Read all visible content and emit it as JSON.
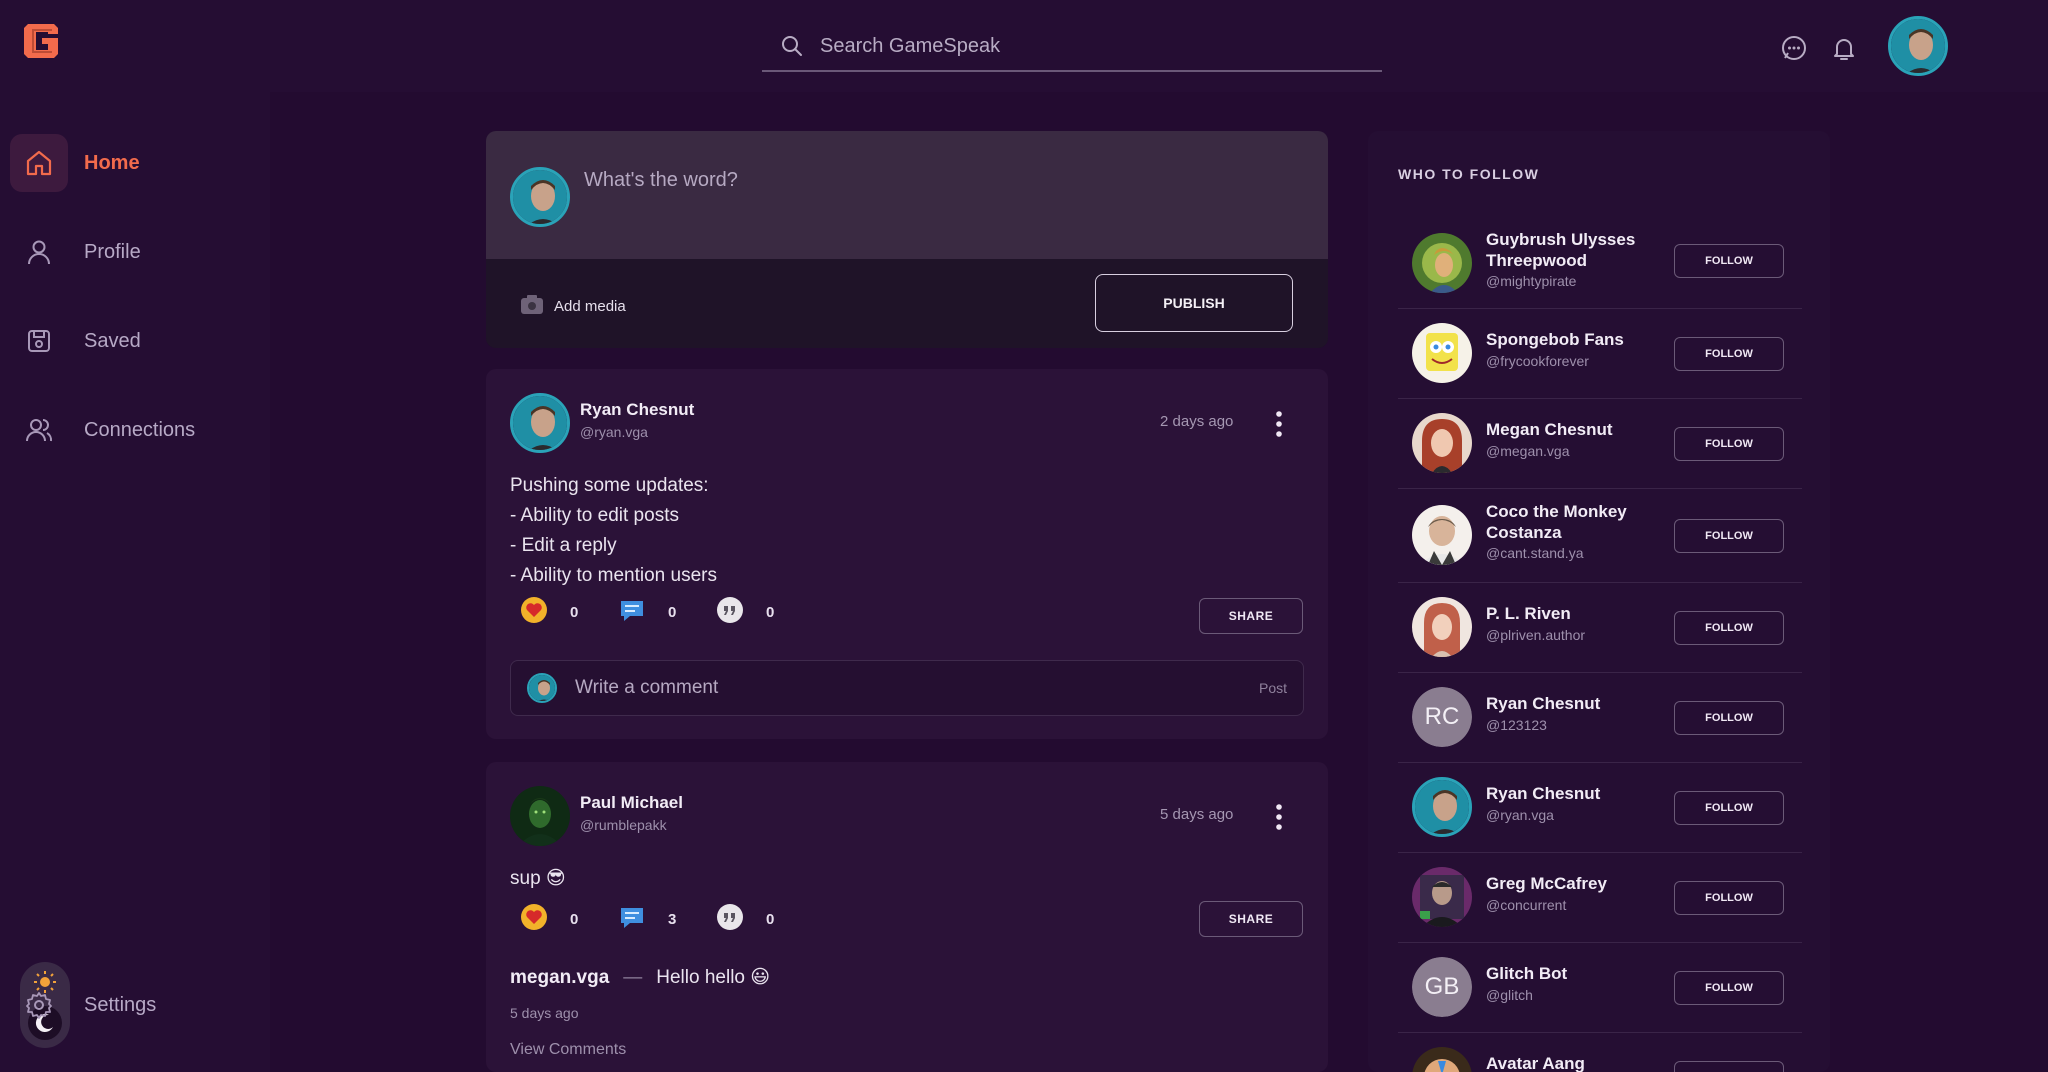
{
  "brand": {
    "accent": "#f26b4c",
    "background": "#230b30"
  },
  "search": {
    "placeholder": "Search GameSpeak"
  },
  "icons": {
    "messages": "chat-bubble-icon",
    "notifications": "bell-icon"
  },
  "sidebar": {
    "items": [
      {
        "label": "Home",
        "icon": "home-icon",
        "active": true
      },
      {
        "label": "Profile",
        "icon": "user-icon",
        "active": false
      },
      {
        "label": "Saved",
        "icon": "save-icon",
        "active": false
      },
      {
        "label": "Connections",
        "icon": "users-icon",
        "active": false
      }
    ],
    "settings_label": "Settings"
  },
  "composer": {
    "placeholder": "What's the word?",
    "add_media_label": "Add media",
    "publish_label": "PUBLISH"
  },
  "posts": [
    {
      "author": "Ryan Chesnut",
      "handle": "@ryan.vga",
      "time": "2 days ago",
      "body": "Pushing some updates:\n- Ability to edit posts\n- Edit a reply\n- Ability to mention users",
      "likes": "0",
      "comments": "0",
      "quotes": "0",
      "share_label": "SHARE",
      "comment_placeholder": "Write a comment",
      "post_label": "Post"
    },
    {
      "author": "Paul Michael",
      "handle": "@rumblepakk",
      "time": "5 days ago",
      "body": "sup 😎",
      "likes": "0",
      "comments": "3",
      "quotes": "0",
      "share_label": "SHARE",
      "reply": {
        "user": "megan.vga",
        "separator": "—",
        "text": "Hello hello 😃",
        "time": "5 days ago"
      },
      "view_comments_label": "View Comments"
    }
  ],
  "who_to_follow": {
    "title": "WHO TO FOLLOW",
    "follow_label": "FOLLOW",
    "users": [
      {
        "name": "Guybrush Ulysses Threepwood",
        "handle": "@mightypirate",
        "avatar_color": "#7c9a3a"
      },
      {
        "name": "Spongebob Fans",
        "handle": "@frycookforever",
        "avatar_color": "#f2e24a"
      },
      {
        "name": "Megan Chesnut",
        "handle": "@megan.vga",
        "avatar_color": "#b5543c"
      },
      {
        "name": "Coco the Monkey Costanza",
        "handle": "@cant.stand.ya",
        "avatar_color": "#c9b8a6"
      },
      {
        "name": "P. L. Riven",
        "handle": "@plriven.author",
        "avatar_color": "#c77a6a"
      },
      {
        "name": "Ryan Chesnut",
        "handle": "@123123",
        "initials": "RC"
      },
      {
        "name": "Ryan Chesnut",
        "handle": "@ryan.vga",
        "avatar_color": "#2aa3b8"
      },
      {
        "name": "Greg McCafrey",
        "handle": "@concurrent",
        "avatar_color": "#4a3a52"
      },
      {
        "name": "Glitch Bot",
        "handle": "@glitch",
        "initials": "GB"
      },
      {
        "name": "Avatar Aang",
        "handle": "",
        "avatar_color": "#c98a5a"
      }
    ]
  }
}
